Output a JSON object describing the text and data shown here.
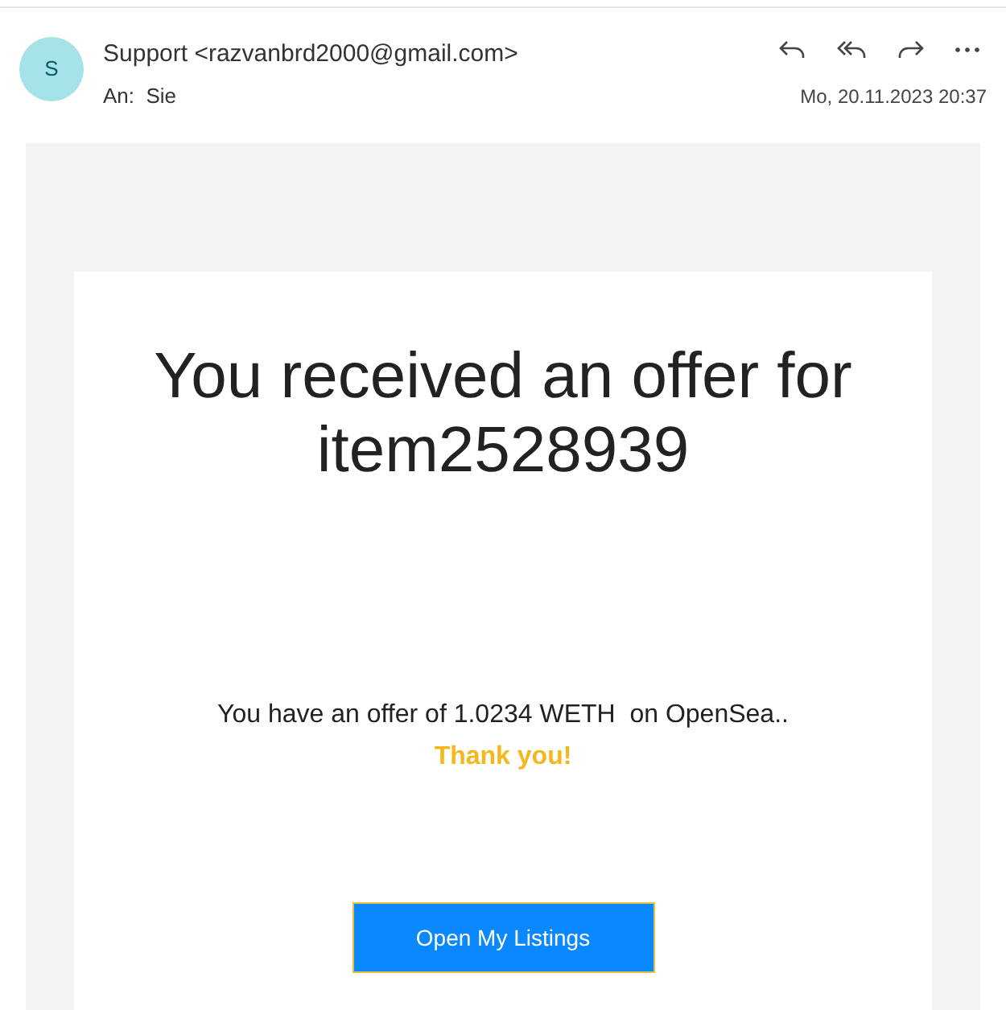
{
  "header": {
    "avatar_initial": "S",
    "sender": "Support <razvanbrd2000@gmail.com>",
    "recipient": "An:  Sie",
    "date": "Mo, 20.11.2023 20:37"
  },
  "email": {
    "heading": "You received an offer for item2528939",
    "message": "You have an offer of 1.0234 WETH  on OpenSea..",
    "thanks": "Thank you!",
    "button": "Open My Listings"
  }
}
